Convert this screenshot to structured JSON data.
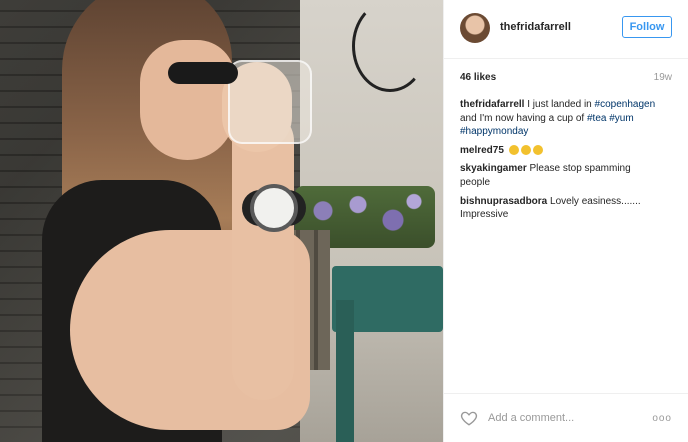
{
  "post": {
    "username": "thefridafarrell",
    "follow_label": "Follow",
    "likes": "46 likes",
    "time": "19w",
    "add_comment_placeholder": "Add a comment...",
    "more_label": "ooo",
    "photo_alt": ""
  },
  "comments": [
    {
      "user": "thefridafarrell",
      "parts": [
        {
          "text": " I just landed in "
        },
        {
          "text": "#copenhagen",
          "tag": true
        },
        {
          "text": " and I'm now having a cup of "
        },
        {
          "text": "#tea",
          "tag": true
        },
        {
          "text": " "
        },
        {
          "text": "#yum",
          "tag": true
        },
        {
          "text": " "
        },
        {
          "text": "#happymonday",
          "tag": true
        }
      ]
    },
    {
      "user": "melred75",
      "text": "",
      "emojis": [
        "clapping-hands",
        "clapping-hands",
        "clapping-hands"
      ]
    },
    {
      "user": "skyakingamer",
      "text": " Please stop spamming people"
    },
    {
      "user": "bishnuprasadbora",
      "text": " Lovely easiness....... Impressive"
    }
  ],
  "colors": {
    "accent": "#3897f0",
    "hashtag": "#003569",
    "muted": "#999999"
  }
}
